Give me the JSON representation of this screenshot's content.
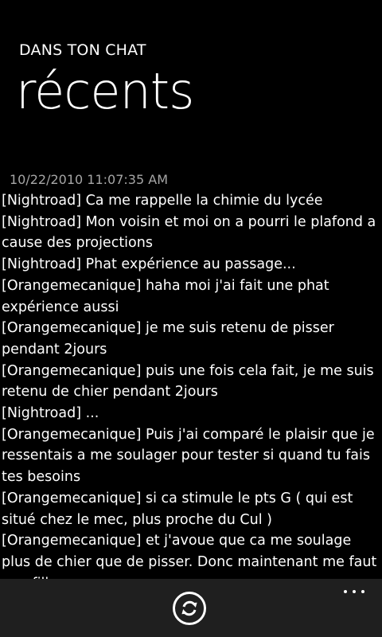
{
  "header": {
    "app_title": "DANS TON CHAT",
    "page_title": "récents"
  },
  "post": {
    "timestamp": "10/22/2010 11:07:35 AM",
    "lines": [
      "[Nightroad] Ca me rappelle la chimie du lycée",
      "[Nightroad] Mon voisin et moi on a pourri le plafond a cause des projections",
      "[Nightroad] Phat expérience au passage...",
      "[Orangemecanique] haha moi j'ai fait une phat expérience aussi",
      "[Orangemecanique] je me suis retenu de pisser pendant 2jours",
      "[Orangemecanique] puis une fois cela fait, je me suis retenu de chier pendant 2jours",
      "[Nightroad] ...",
      "[Orangemecanique] Puis j'ai comparé le plaisir que je ressentais a me soulager pour tester si quand tu fais tes besoins",
      "[Orangemecanique] si ca stimule le pts G ( qui est situé chez le mec, plus proche du Cul )",
      "[Orangemecanique] et j'avoue que ca me soulage plus de chier que de pisser. Donc maintenant me faut une fille"
    ]
  },
  "app_bar": {
    "refresh_icon": "refresh-icon",
    "more_icon": "more-icon",
    "background": "#1f1f1f"
  }
}
